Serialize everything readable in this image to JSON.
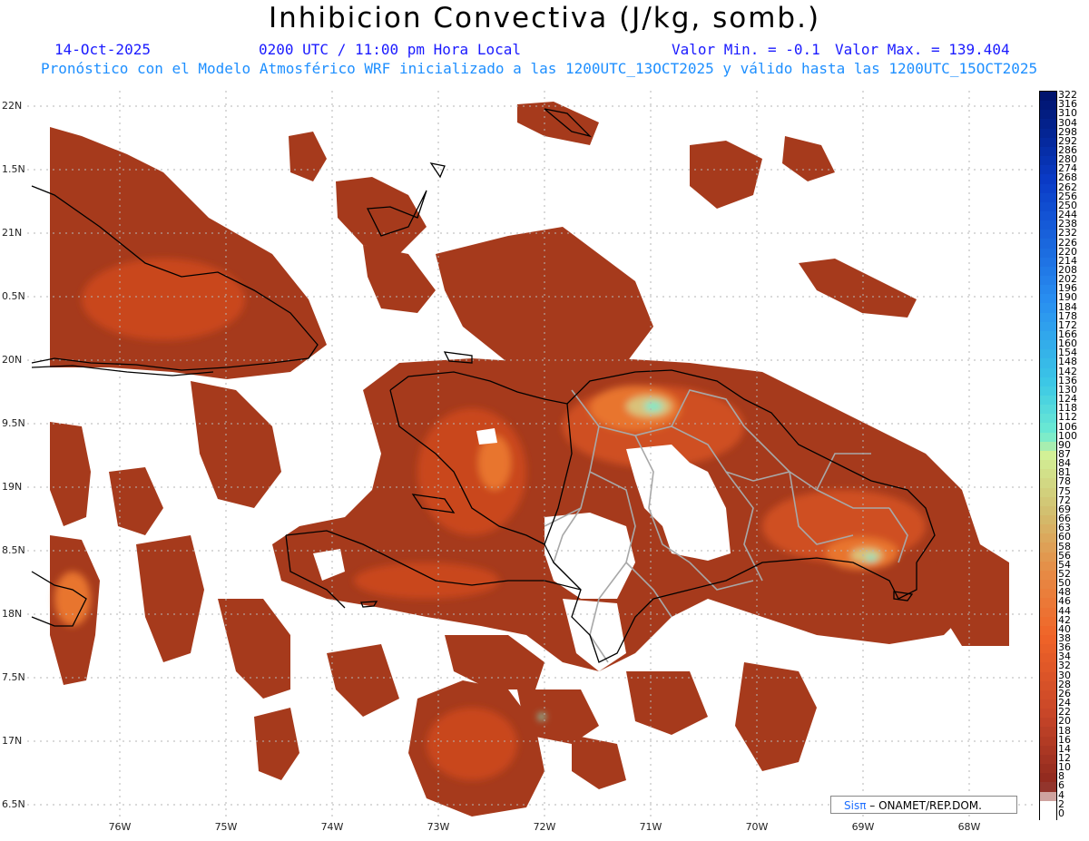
{
  "header": {
    "title": "Inhibicion Convectiva (J/kg, somb.)",
    "date": "14-Oct-2025",
    "time": "0200 UTC / 11:00 pm Hora Local",
    "value_min": "Valor Min. = -0.1",
    "value_max": "Valor Max. = 139.404",
    "subtitle": "Pronóstico con el Modelo Atmosférico WRF inicializado a las 1200UTC_13OCT2025 y válido hasta las  1200UTC_15OCT2025"
  },
  "map": {
    "lat_labels": [
      "22N",
      "1.5N",
      "21N",
      "0.5N",
      "20N",
      "9.5N",
      "19N",
      "8.5N",
      "18N",
      "7.5N",
      "17N",
      "6.5N"
    ],
    "lon_labels": [
      "76W",
      "75W",
      "74W",
      "73W",
      "72W",
      "71W",
      "70W",
      "69W",
      "68W"
    ],
    "colors": {
      "field_base": "#a63a1c",
      "field_mid": "#c9471d",
      "field_high": "#e8752e",
      "field_peak": "#d9c27a",
      "field_max": "#7fe8c8",
      "coastline": "#000000",
      "provinces": "#a8a8a8",
      "grid": "#b5b5b5"
    }
  },
  "colorbar": {
    "labels": [
      "322",
      "316",
      "310",
      "304",
      "298",
      "292",
      "286",
      "280",
      "274",
      "268",
      "262",
      "256",
      "250",
      "244",
      "238",
      "232",
      "226",
      "220",
      "214",
      "208",
      "202",
      "196",
      "190",
      "184",
      "178",
      "172",
      "166",
      "160",
      "154",
      "148",
      "142",
      "136",
      "130",
      "124",
      "118",
      "112",
      "106",
      "100",
      "90",
      "87",
      "84",
      "81",
      "78",
      "75",
      "72",
      "69",
      "66",
      "63",
      "60",
      "58",
      "56",
      "54",
      "52",
      "50",
      "48",
      "46",
      "44",
      "42",
      "40",
      "38",
      "36",
      "34",
      "32",
      "30",
      "28",
      "26",
      "24",
      "22",
      "20",
      "18",
      "16",
      "14",
      "12",
      "10",
      "8",
      "6",
      "4",
      "2",
      "0"
    ]
  },
  "credit": {
    "sis": "Sisπ",
    "text": "– ONAMET/REP.DOM."
  }
}
